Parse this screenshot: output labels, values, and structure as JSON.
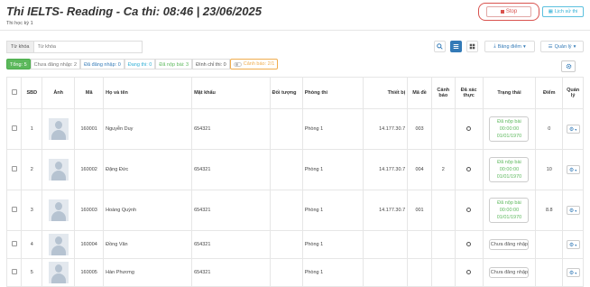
{
  "header": {
    "title": "Thi IELTS- Reading - Ca thi: 08:46 | 23/06/2025",
    "subtitle": "Thi học kỳ 1",
    "stop_label": "Stop",
    "history_label": "Lịch sử thi"
  },
  "search": {
    "label": "Từ khóa",
    "placeholder": "Từ khóa"
  },
  "toolbar": {
    "grade_label": "Bảng điểm",
    "manage_label": "Quản lý"
  },
  "filters": {
    "total": "Tổng: 5",
    "not_logged": "Chưa đăng nhập: 2",
    "logged": "Đã đăng nhập: 0",
    "taking": "Đang thi: 0",
    "submitted": "Đã nộp bài: 3",
    "suspended": "Đình chỉ thi: 0",
    "warning": "Cảnh báo: 2/1"
  },
  "table": {
    "headers": [
      "",
      "SBD",
      "Ảnh",
      "Mã",
      "Họ và tên",
      "Mật khẩu",
      "Đối tượng",
      "Phòng thi",
      "Thiết bị",
      "Mã đề",
      "Cảnh báo",
      "Đã xác thực",
      "Trạng thái",
      "Điểm",
      "Quản lý"
    ],
    "rows": [
      {
        "sbd": "1",
        "code": "160001",
        "name": "Nguyễn Duy",
        "password": "654321",
        "target": "",
        "room": "Phòng 1",
        "device": "14.177.30.7",
        "exam_code": "003",
        "warning": "",
        "status": "Đã nộp bài 00:00:00 01/01/1970",
        "score": "0"
      },
      {
        "sbd": "2",
        "code": "160002",
        "name": "Đặng Đức",
        "password": "654321",
        "target": "",
        "room": "Phòng 1",
        "device": "14.177.30.7",
        "exam_code": "004",
        "warning": "2",
        "status": "Đã nộp bài 00:00:00 01/01/1970",
        "score": "10"
      },
      {
        "sbd": "3",
        "code": "160003",
        "name": "Hoàng Quỳnh",
        "password": "654321",
        "target": "",
        "room": "Phòng 1",
        "device": "14.177.30.7",
        "exam_code": "001",
        "warning": "",
        "status": "Đã nộp bài 00:00:00 01/01/1970",
        "score": "8.8"
      },
      {
        "sbd": "4",
        "code": "160004",
        "name": "Đồng Văn",
        "password": "654321",
        "target": "",
        "room": "Phòng 1",
        "device": "",
        "exam_code": "",
        "warning": "",
        "status": "Chưa đăng nhập",
        "score": ""
      },
      {
        "sbd": "5",
        "code": "160005",
        "name": "Hàn Phương",
        "password": "654321",
        "target": "",
        "room": "Phòng 1",
        "device": "",
        "exam_code": "",
        "warning": "",
        "status": "Chưa đăng nhập",
        "score": ""
      }
    ]
  },
  "icons": {
    "stop": "stop-square-icon",
    "history": "history-icon",
    "search": "search-icon",
    "list_view": "list-icon",
    "grid_view": "grid-icon",
    "gear": "gear-icon"
  },
  "colors": {
    "danger": "#d9534f",
    "primary": "#337ab7",
    "info": "#31b0d5",
    "success": "#5cb85c",
    "warning": "#f0ad4e"
  }
}
